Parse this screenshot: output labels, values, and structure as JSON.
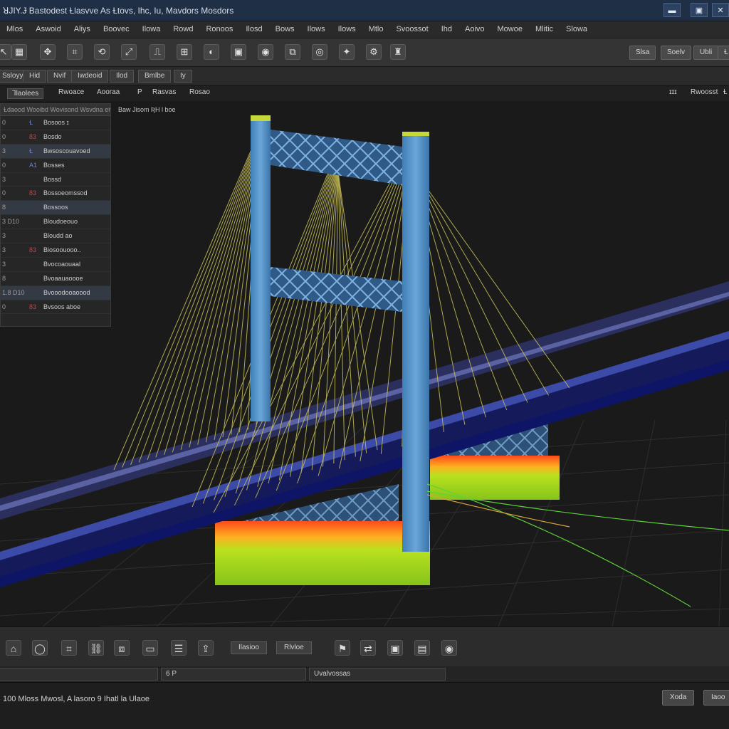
{
  "window": {
    "title": "ꓤJIY.Ɉ Bastodest Ɫlasvve As Ɫtovs, Ihc, Iu, Mavdors Mosdors",
    "controls": [
      "▬",
      "▣",
      "✕"
    ]
  },
  "menu": [
    "Mlos",
    "Aswoid",
    "Aliys",
    "Boovec",
    "Ilowa",
    "Rowd",
    "Ronoos",
    "Ilosd",
    "Bows",
    "Ilows",
    "Ilows",
    "Mtlo",
    "Svoossot",
    "Ihd",
    "Aoivo",
    "Mowoe",
    "Mlitic",
    "Slowa"
  ],
  "toolbar": {
    "icons": [
      "cursor-icon",
      "grid-icon",
      "move-icon",
      "node-icon",
      "rotate-icon",
      "scale-icon",
      "pipe-icon",
      "mesh-icon",
      "circle-icon",
      "render-icon",
      "sphere-icon",
      "camera-icon",
      "target-icon",
      "light-icon"
    ],
    "buttons": [
      "Slsa",
      "Soelv",
      "Ubli",
      "Ɫ"
    ]
  },
  "tabs": [
    "Ssloyyy",
    "Hid",
    "Nvif",
    "Iwdeoid",
    "Ilod",
    "Bmlbe",
    "Iy"
  ],
  "viewport": {
    "tabs": [
      "Ꞁlaolees",
      "Rwoace",
      "Aooraa",
      "P",
      "Rasvas",
      "Rosao"
    ],
    "right_controls": [
      "ɪɪɪ",
      "Rwoosst",
      "Ɫ"
    ],
    "caption": "Baw Jisom  ƦH l boe",
    "outliner_header": "Ɫdaood Wooibd Wovisond Wsvdna eiws cer",
    "outliner_rows": [
      {
        "num": "0",
        "tag": "Ɫ",
        "tag_color": "blue",
        "label": "Bosoos ɪ"
      },
      {
        "num": "0",
        "tag": "83",
        "tag_color": "red",
        "label": "Bosdo"
      },
      {
        "num": "3",
        "tag": "Ɫ",
        "tag_color": "blue",
        "label": "Bwsoscouavoed"
      },
      {
        "num": "0",
        "tag": "A1",
        "tag_color": "blue",
        "label": "Bosses"
      },
      {
        "num": "3",
        "tag": "",
        "tag_color": "red",
        "label": "Bossd"
      },
      {
        "num": "0",
        "tag": "83",
        "tag_color": "red",
        "label": "Bossoeomssod"
      },
      {
        "num": "8",
        "tag": "",
        "tag_color": "red",
        "label": "Bossoos"
      },
      {
        "num": "3  D10",
        "tag": "",
        "tag_color": "red",
        "label": "Bloudoeouo"
      },
      {
        "num": "3",
        "tag": "",
        "tag_color": "red",
        "label": "Bloudd ao"
      },
      {
        "num": "3",
        "tag": "83",
        "tag_color": "red",
        "label": "Biosoouooo.."
      },
      {
        "num": "3",
        "tag": "",
        "tag_color": "red",
        "label": "Bvocoaouaal"
      },
      {
        "num": "8",
        "tag": "",
        "tag_color": "red",
        "label": "Bvoaauaoooe"
      },
      {
        "num": "1.8  D10",
        "tag": "",
        "tag_color": "red",
        "label": "Bvooodooaoood"
      },
      {
        "num": "0",
        "tag": "83",
        "tag_color": "red",
        "label": "Bvsoos aboe"
      }
    ]
  },
  "bottom": {
    "icons": [
      "sphere-icon",
      "circle-icon",
      "node-icon",
      "link-icon",
      "cube-icon",
      "monitor-icon",
      "layers-icon",
      "export-icon",
      "bucket-icon",
      "share-icon",
      "frame-icon",
      "panel-icon",
      "globe-icon"
    ],
    "buttons": [
      "Ilasioo",
      "Rlvloe"
    ],
    "fields": [
      "",
      "6 P",
      "Uvalvossas"
    ]
  },
  "status": {
    "text": "100 Mloss Mwosl, A lasoro 9 Ihatl la Ulaoe",
    "buttons": [
      "Xoda",
      "Iaoo"
    ]
  },
  "colors": {
    "tower": "#4f8fc7",
    "deck": "#1a237e",
    "cables": "#c9c15a",
    "pier_top": "#ff5a1f",
    "pier_body": "#9bd21e",
    "grid": "#2d2d2d"
  }
}
